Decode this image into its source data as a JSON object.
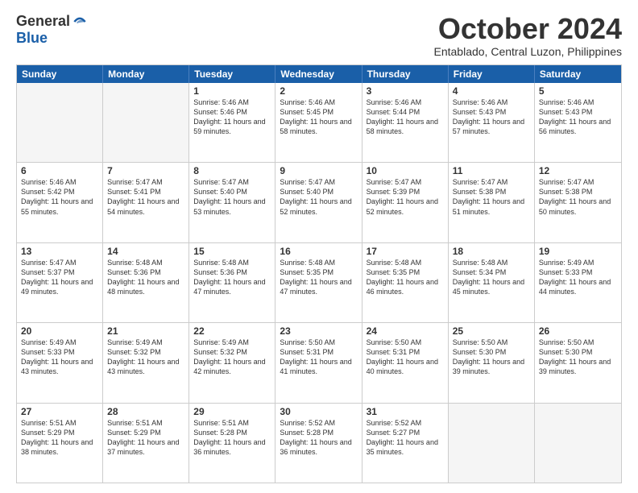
{
  "logo": {
    "general": "General",
    "blue": "Blue"
  },
  "title": "October 2024",
  "subtitle": "Entablado, Central Luzon, Philippines",
  "weekdays": [
    "Sunday",
    "Monday",
    "Tuesday",
    "Wednesday",
    "Thursday",
    "Friday",
    "Saturday"
  ],
  "weeks": [
    [
      {
        "day": "",
        "sunrise": "",
        "sunset": "",
        "daylight": "",
        "empty": true
      },
      {
        "day": "",
        "sunrise": "",
        "sunset": "",
        "daylight": "",
        "empty": true
      },
      {
        "day": "1",
        "sunrise": "Sunrise: 5:46 AM",
        "sunset": "Sunset: 5:46 PM",
        "daylight": "Daylight: 11 hours and 59 minutes."
      },
      {
        "day": "2",
        "sunrise": "Sunrise: 5:46 AM",
        "sunset": "Sunset: 5:45 PM",
        "daylight": "Daylight: 11 hours and 58 minutes."
      },
      {
        "day": "3",
        "sunrise": "Sunrise: 5:46 AM",
        "sunset": "Sunset: 5:44 PM",
        "daylight": "Daylight: 11 hours and 58 minutes."
      },
      {
        "day": "4",
        "sunrise": "Sunrise: 5:46 AM",
        "sunset": "Sunset: 5:43 PM",
        "daylight": "Daylight: 11 hours and 57 minutes."
      },
      {
        "day": "5",
        "sunrise": "Sunrise: 5:46 AM",
        "sunset": "Sunset: 5:43 PM",
        "daylight": "Daylight: 11 hours and 56 minutes."
      }
    ],
    [
      {
        "day": "6",
        "sunrise": "Sunrise: 5:46 AM",
        "sunset": "Sunset: 5:42 PM",
        "daylight": "Daylight: 11 hours and 55 minutes."
      },
      {
        "day": "7",
        "sunrise": "Sunrise: 5:47 AM",
        "sunset": "Sunset: 5:41 PM",
        "daylight": "Daylight: 11 hours and 54 minutes."
      },
      {
        "day": "8",
        "sunrise": "Sunrise: 5:47 AM",
        "sunset": "Sunset: 5:40 PM",
        "daylight": "Daylight: 11 hours and 53 minutes."
      },
      {
        "day": "9",
        "sunrise": "Sunrise: 5:47 AM",
        "sunset": "Sunset: 5:40 PM",
        "daylight": "Daylight: 11 hours and 52 minutes."
      },
      {
        "day": "10",
        "sunrise": "Sunrise: 5:47 AM",
        "sunset": "Sunset: 5:39 PM",
        "daylight": "Daylight: 11 hours and 52 minutes."
      },
      {
        "day": "11",
        "sunrise": "Sunrise: 5:47 AM",
        "sunset": "Sunset: 5:38 PM",
        "daylight": "Daylight: 11 hours and 51 minutes."
      },
      {
        "day": "12",
        "sunrise": "Sunrise: 5:47 AM",
        "sunset": "Sunset: 5:38 PM",
        "daylight": "Daylight: 11 hours and 50 minutes."
      }
    ],
    [
      {
        "day": "13",
        "sunrise": "Sunrise: 5:47 AM",
        "sunset": "Sunset: 5:37 PM",
        "daylight": "Daylight: 11 hours and 49 minutes."
      },
      {
        "day": "14",
        "sunrise": "Sunrise: 5:48 AM",
        "sunset": "Sunset: 5:36 PM",
        "daylight": "Daylight: 11 hours and 48 minutes."
      },
      {
        "day": "15",
        "sunrise": "Sunrise: 5:48 AM",
        "sunset": "Sunset: 5:36 PM",
        "daylight": "Daylight: 11 hours and 47 minutes."
      },
      {
        "day": "16",
        "sunrise": "Sunrise: 5:48 AM",
        "sunset": "Sunset: 5:35 PM",
        "daylight": "Daylight: 11 hours and 47 minutes."
      },
      {
        "day": "17",
        "sunrise": "Sunrise: 5:48 AM",
        "sunset": "Sunset: 5:35 PM",
        "daylight": "Daylight: 11 hours and 46 minutes."
      },
      {
        "day": "18",
        "sunrise": "Sunrise: 5:48 AM",
        "sunset": "Sunset: 5:34 PM",
        "daylight": "Daylight: 11 hours and 45 minutes."
      },
      {
        "day": "19",
        "sunrise": "Sunrise: 5:49 AM",
        "sunset": "Sunset: 5:33 PM",
        "daylight": "Daylight: 11 hours and 44 minutes."
      }
    ],
    [
      {
        "day": "20",
        "sunrise": "Sunrise: 5:49 AM",
        "sunset": "Sunset: 5:33 PM",
        "daylight": "Daylight: 11 hours and 43 minutes."
      },
      {
        "day": "21",
        "sunrise": "Sunrise: 5:49 AM",
        "sunset": "Sunset: 5:32 PM",
        "daylight": "Daylight: 11 hours and 43 minutes."
      },
      {
        "day": "22",
        "sunrise": "Sunrise: 5:49 AM",
        "sunset": "Sunset: 5:32 PM",
        "daylight": "Daylight: 11 hours and 42 minutes."
      },
      {
        "day": "23",
        "sunrise": "Sunrise: 5:50 AM",
        "sunset": "Sunset: 5:31 PM",
        "daylight": "Daylight: 11 hours and 41 minutes."
      },
      {
        "day": "24",
        "sunrise": "Sunrise: 5:50 AM",
        "sunset": "Sunset: 5:31 PM",
        "daylight": "Daylight: 11 hours and 40 minutes."
      },
      {
        "day": "25",
        "sunrise": "Sunrise: 5:50 AM",
        "sunset": "Sunset: 5:30 PM",
        "daylight": "Daylight: 11 hours and 39 minutes."
      },
      {
        "day": "26",
        "sunrise": "Sunrise: 5:50 AM",
        "sunset": "Sunset: 5:30 PM",
        "daylight": "Daylight: 11 hours and 39 minutes."
      }
    ],
    [
      {
        "day": "27",
        "sunrise": "Sunrise: 5:51 AM",
        "sunset": "Sunset: 5:29 PM",
        "daylight": "Daylight: 11 hours and 38 minutes."
      },
      {
        "day": "28",
        "sunrise": "Sunrise: 5:51 AM",
        "sunset": "Sunset: 5:29 PM",
        "daylight": "Daylight: 11 hours and 37 minutes."
      },
      {
        "day": "29",
        "sunrise": "Sunrise: 5:51 AM",
        "sunset": "Sunset: 5:28 PM",
        "daylight": "Daylight: 11 hours and 36 minutes."
      },
      {
        "day": "30",
        "sunrise": "Sunrise: 5:52 AM",
        "sunset": "Sunset: 5:28 PM",
        "daylight": "Daylight: 11 hours and 36 minutes."
      },
      {
        "day": "31",
        "sunrise": "Sunrise: 5:52 AM",
        "sunset": "Sunset: 5:27 PM",
        "daylight": "Daylight: 11 hours and 35 minutes."
      },
      {
        "day": "",
        "sunrise": "",
        "sunset": "",
        "daylight": "",
        "empty": true
      },
      {
        "day": "",
        "sunrise": "",
        "sunset": "",
        "daylight": "",
        "empty": true
      }
    ]
  ]
}
